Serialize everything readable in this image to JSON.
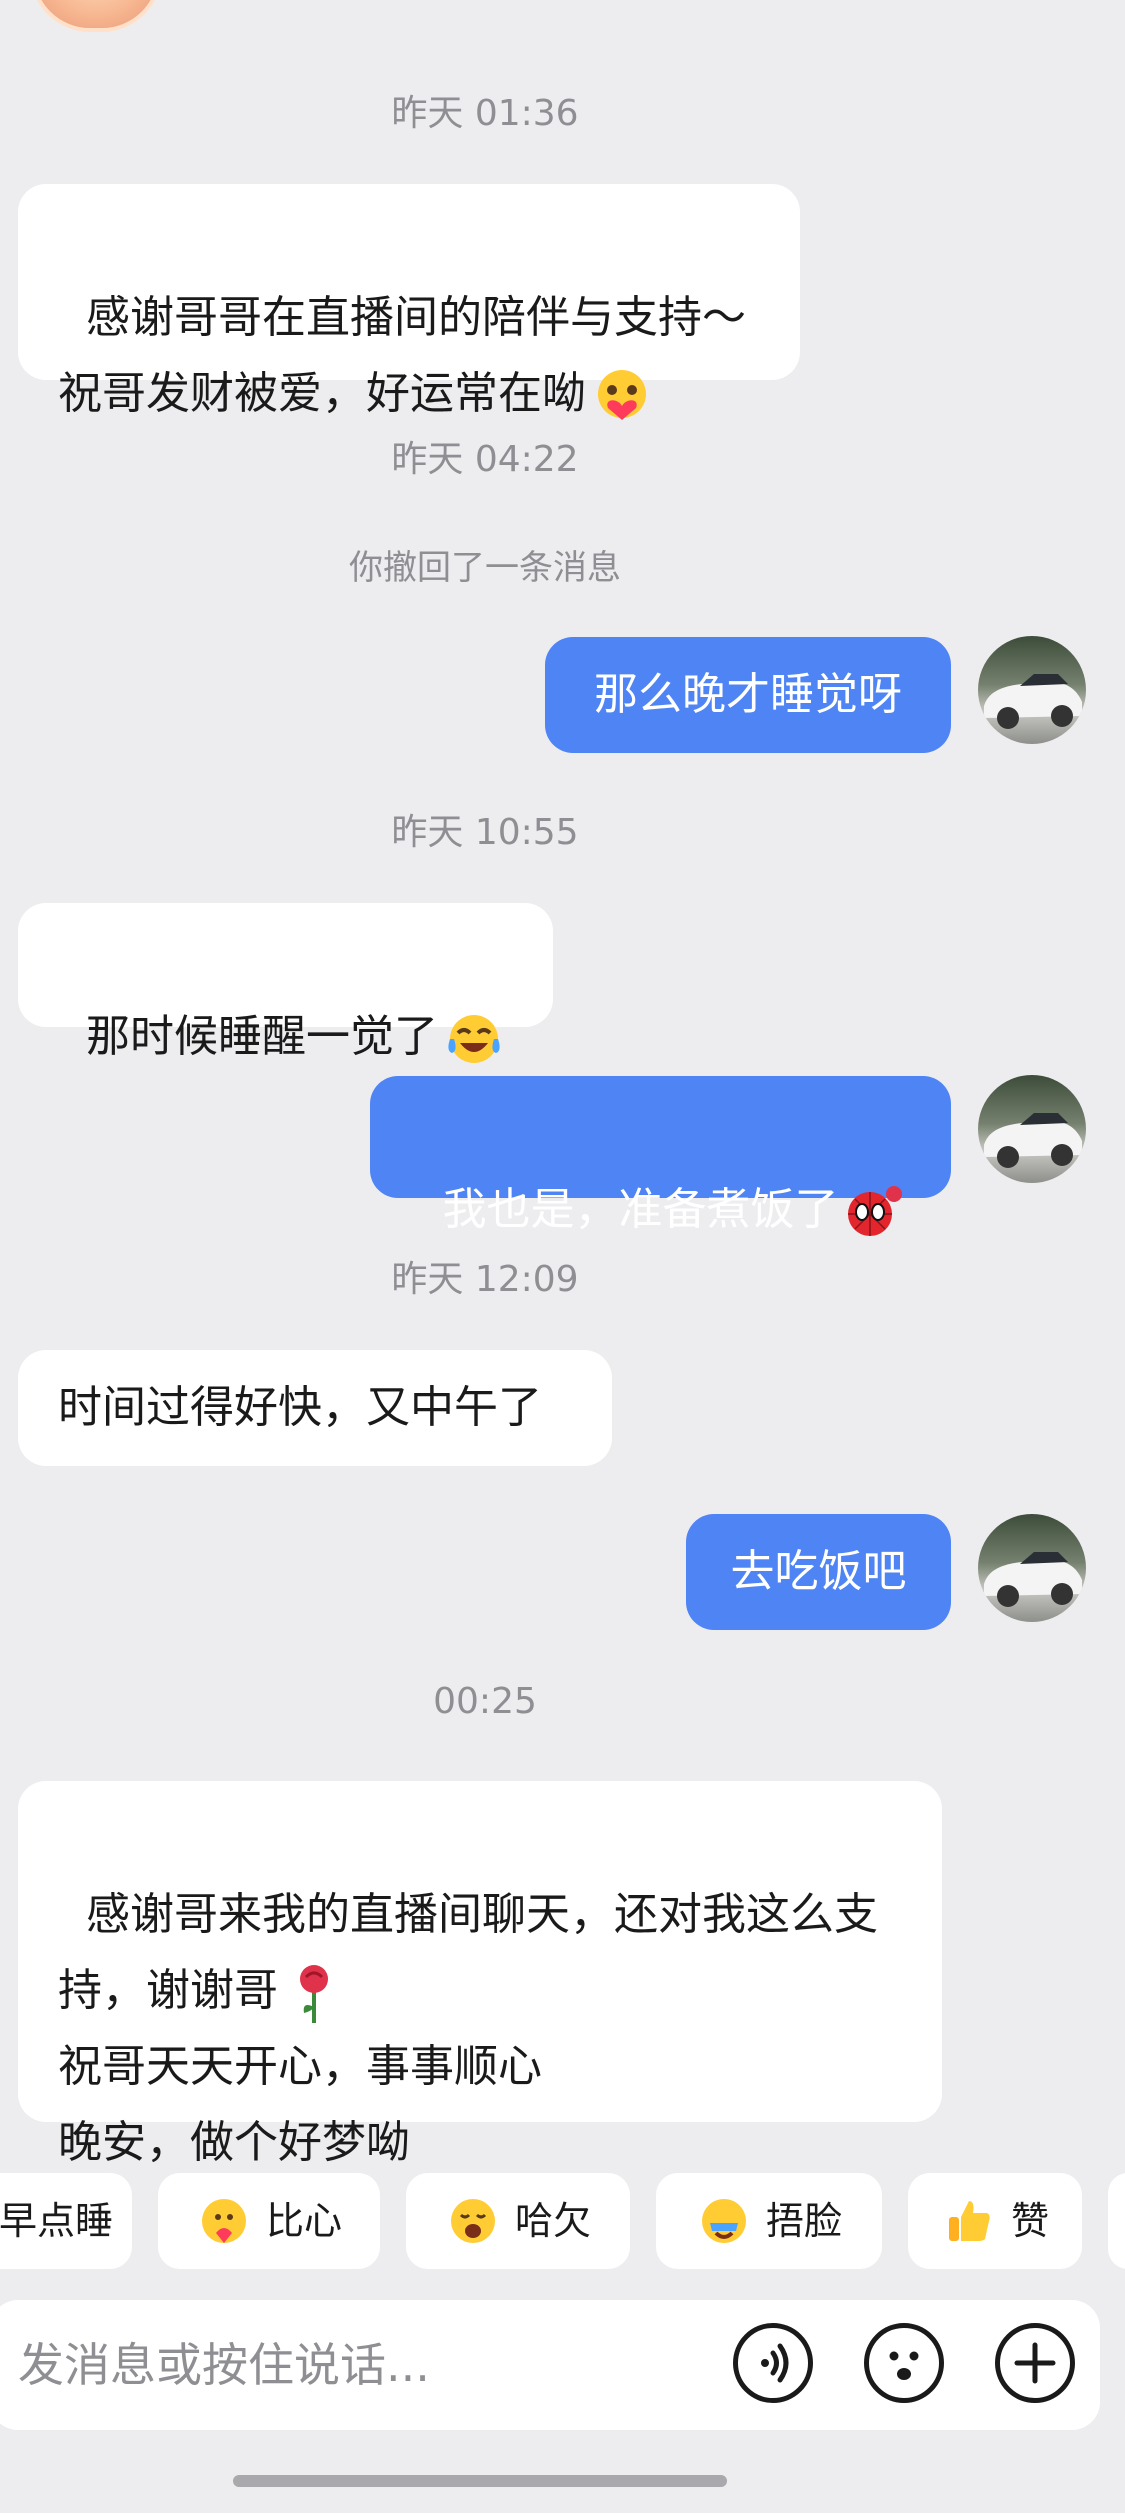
{
  "chat": {
    "t1": "昨天 01:36",
    "m1": "感谢哥哥在直播间的陪伴与支持～\n祝哥发财被爱，好运常在呦",
    "t2": "昨天 04:22",
    "recall_notice": "你撤回了一条消息",
    "m2": "那么晚才睡觉呀",
    "t3": "昨天 10:55",
    "m3": "那时候睡醒一觉了",
    "m4": "我也是，准备煮饭了",
    "t4": "昨天 12:09",
    "m5": "时间过得好快，又中午了",
    "m6": "去吃饭吧",
    "t5": "00:25",
    "m7a": "感谢哥来我的直播间聊天，还对我这么支持，谢谢哥",
    "m7b": "祝哥天天开心，事事顺心\n晚安，做个好梦呦"
  },
  "quick_replies": [
    {
      "label": "早点睡",
      "icon": "sleep-icon"
    },
    {
      "label": "比心",
      "icon": "heart-hands-icon"
    },
    {
      "label": "哈欠",
      "icon": "yawn-icon"
    },
    {
      "label": "捂脸",
      "icon": "facepalm-icon"
    },
    {
      "label": "赞",
      "icon": "thumbs-up-icon"
    }
  ],
  "input": {
    "placeholder": "发消息或按住说话..."
  },
  "colors": {
    "background": "#ededf0",
    "outgoing_bubble": "#4f84f5",
    "incoming_bubble": "#ffffff",
    "timestamp": "#8e8e93"
  }
}
